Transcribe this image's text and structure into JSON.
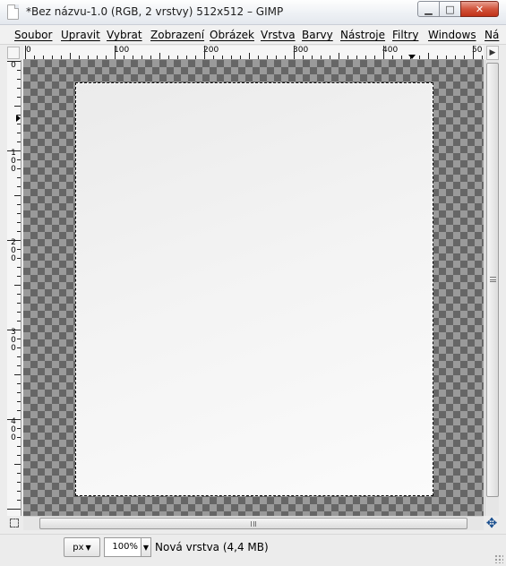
{
  "window": {
    "title": "*Bez názvu-1.0 (RGB, 2 vrstvy) 512x512 – GIMP",
    "minimize_icon": "minimize-icon",
    "maximize_icon": "maximize-icon",
    "close_icon": "close-icon",
    "minimize_glyph": "▁",
    "maximize_glyph": "□",
    "close_glyph": "✕"
  },
  "menu": {
    "items": [
      "Soubor",
      "Upravit",
      "Vybrat",
      "Zobrazení",
      "Obrázek",
      "Vrstva",
      "Barvy",
      "Nástroje",
      "Filtry",
      "Windows",
      "Ná"
    ]
  },
  "rulers": {
    "horizontal_labels": [
      "0",
      "100",
      "200",
      "300",
      "400",
      "50"
    ],
    "vertical_labels": [
      "0",
      "100",
      "200",
      "300",
      "400"
    ]
  },
  "status": {
    "unit": "px",
    "zoom": "100%",
    "message": "Nová vrstva (4,4 MB)"
  },
  "colors": {
    "checker_dark": "#666666",
    "checker_light": "#9a9a9a",
    "layer_fill": "#f3f3f3"
  }
}
